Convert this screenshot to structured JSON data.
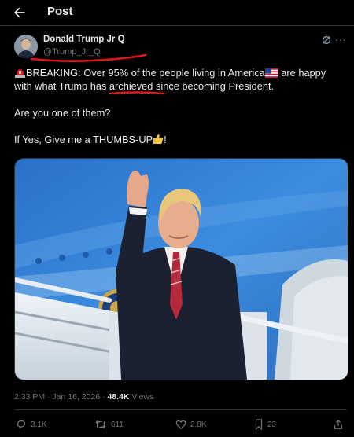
{
  "header": {
    "title": "Post",
    "back_icon": "arrow-left-icon"
  },
  "author": {
    "name": "Donald Trump Jr Q",
    "handle": "@Trump_Jr_Q"
  },
  "post": {
    "line1_prefix": "BREAKING: Over 95% of  the people living in America",
    "line1_suffix": " are happy",
    "line2_before": "with what Trump has ",
    "line2_word": "archieved",
    "line2_after": " since becoming President.",
    "question": "Are you one of them?",
    "cta": "If Yes, Give me a THUMBS-UP",
    "cta_end": "!",
    "emoji_siren": "siren-emoji",
    "emoji_flag": "us-flag-emoji",
    "emoji_thumbs": "thumbs-up-emoji"
  },
  "meta": {
    "time": "2:33 PM · Jan 16, 2026 · ",
    "views_count": "48.4K",
    "views_label": " Views"
  },
  "actions": {
    "replies": "3.1K",
    "reposts": "611",
    "likes": "2.8K",
    "bookmarks": "23"
  },
  "colors": {
    "background": "#000000",
    "text": "#e7e9ea",
    "muted": "#71767b",
    "annotation": "#e0161c"
  }
}
